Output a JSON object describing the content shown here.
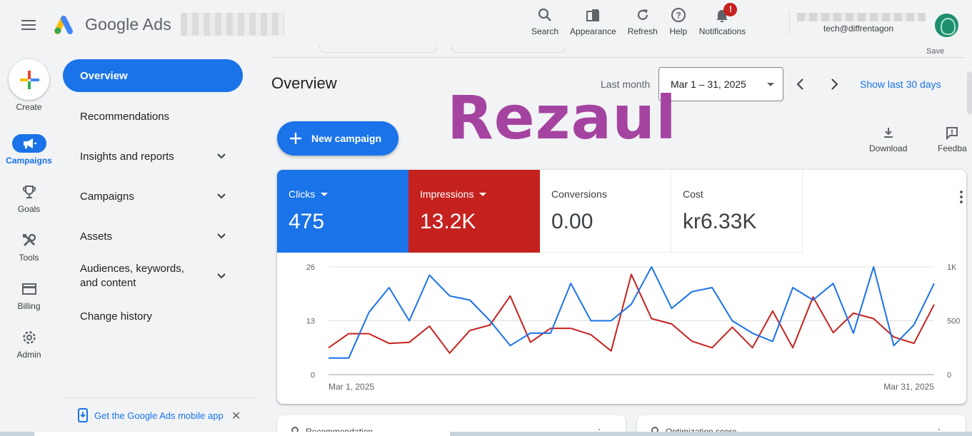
{
  "header": {
    "product_name": "Google Ads",
    "actions": [
      {
        "label": "Search",
        "icon": "search-icon"
      },
      {
        "label": "Appearance",
        "icon": "appearance-icon"
      },
      {
        "label": "Refresh",
        "icon": "refresh-icon"
      },
      {
        "label": "Help",
        "icon": "help-icon"
      },
      {
        "label": "Notifications",
        "icon": "bell-icon",
        "badge": "!"
      }
    ],
    "account_email": "tech@diffrentagon"
  },
  "rail": {
    "create_label": "Create",
    "items": [
      {
        "label": "Campaigns",
        "icon": "campaigns-megaphone-icon",
        "active": true
      },
      {
        "label": "Goals",
        "icon": "trophy-icon"
      },
      {
        "label": "Tools",
        "icon": "tools-icon"
      },
      {
        "label": "Billing",
        "icon": "billing-card-icon"
      },
      {
        "label": "Admin",
        "icon": "gear-icon"
      }
    ]
  },
  "sidenav": {
    "items": [
      {
        "label": "Overview",
        "active": true,
        "expandable": false
      },
      {
        "label": "Recommendations",
        "expandable": false
      },
      {
        "label": "Insights and reports",
        "expandable": true
      },
      {
        "label": "Campaigns",
        "expandable": true
      },
      {
        "label": "Assets",
        "expandable": true
      },
      {
        "label": "Audiences, keywords, and content",
        "expandable": true
      },
      {
        "label": "Change history",
        "expandable": false
      }
    ],
    "mobile_app_link": "Get the Google Ads mobile app",
    "close_symbol": "✕"
  },
  "main": {
    "save_label": "Save",
    "title": "Overview",
    "period_label": "Last month",
    "date_range": "Mar 1 – 31, 2025",
    "show_last_link": "Show last 30 days",
    "watermark": "Rezaul",
    "new_campaign_label": "New campaign",
    "download_label": "Download",
    "feedback_label": "Feedba",
    "bottom_cards": [
      "Recommendation",
      "Optimization score"
    ]
  },
  "metrics": [
    {
      "label": "Clicks",
      "value": "475",
      "color": "#1a73e8",
      "dropdown": true
    },
    {
      "label": "Impressions",
      "value": "13.2K",
      "color": "#c5221f",
      "dropdown": true
    },
    {
      "label": "Conversions",
      "value": "0.00",
      "dropdown": false
    },
    {
      "label": "Cost",
      "value": "kr6.33K",
      "dropdown": false
    }
  ],
  "chart_data": {
    "type": "line",
    "x_start_label": "Mar 1, 2025",
    "x_end_label": "Mar 31, 2025",
    "left_axis": {
      "ticks": [
        "0",
        "13",
        "26"
      ],
      "max": 26
    },
    "right_axis": {
      "ticks": [
        "0",
        "500",
        "1K"
      ],
      "max": 1000
    },
    "grid": true,
    "series": [
      {
        "name": "Clicks",
        "axis": "left",
        "color": "#1a73e8",
        "values": [
          4,
          4,
          15,
          21,
          13,
          24,
          19,
          18,
          13,
          7,
          10,
          10,
          22,
          13,
          13,
          17,
          26,
          16,
          20,
          21,
          13,
          10,
          8,
          21,
          18,
          22,
          10,
          26,
          7,
          12,
          22
        ]
      },
      {
        "name": "Impressions",
        "axis": "right",
        "color": "#c5221f",
        "values": [
          250,
          380,
          380,
          290,
          300,
          450,
          200,
          410,
          460,
          730,
          300,
          430,
          430,
          370,
          220,
          930,
          520,
          470,
          310,
          250,
          440,
          250,
          590,
          250,
          720,
          390,
          570,
          520,
          350,
          290,
          650
        ]
      }
    ]
  }
}
